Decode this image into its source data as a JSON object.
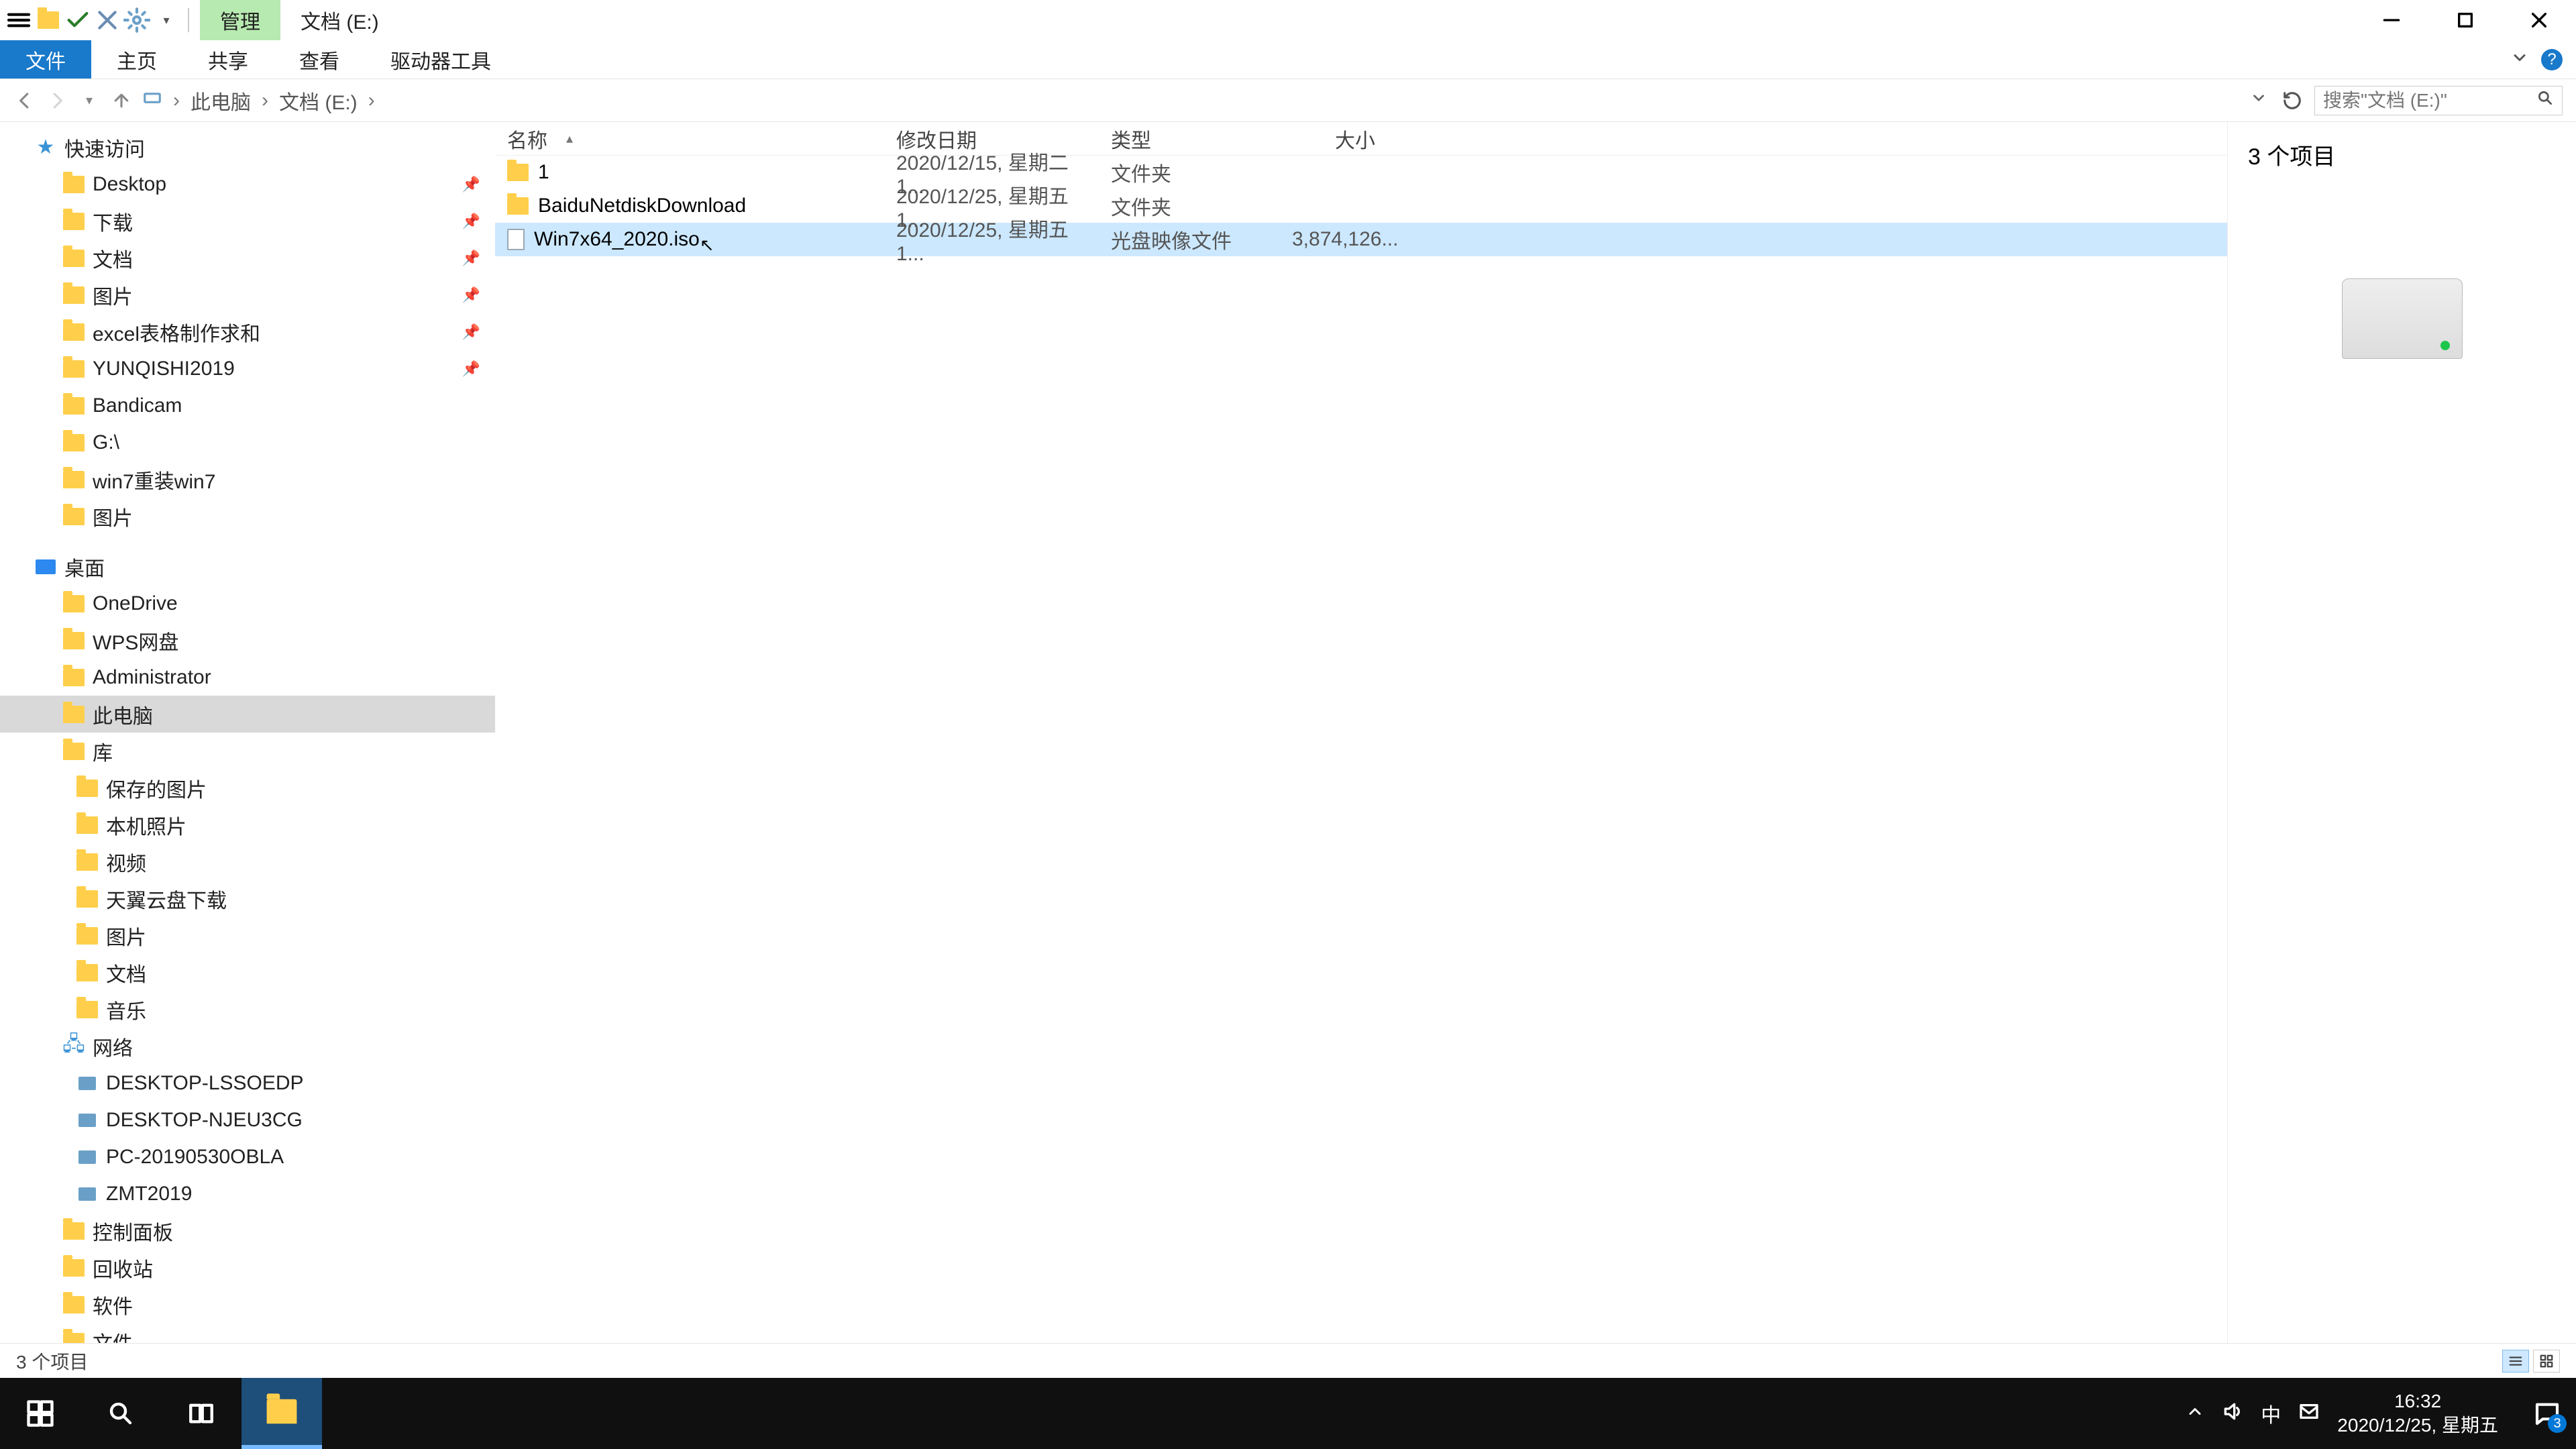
{
  "window": {
    "title": "文档 (E:)",
    "context_tab": "管理"
  },
  "ribbon": {
    "file": "文件",
    "home": "主页",
    "share": "共享",
    "view": "查看",
    "drive_tools": "驱动器工具"
  },
  "breadcrumb": {
    "root": "此电脑",
    "current": "文档 (E:)"
  },
  "search": {
    "placeholder": "搜索\"文档 (E:)\""
  },
  "columns": {
    "name": "名称",
    "date": "修改日期",
    "type": "类型",
    "size": "大小"
  },
  "rows": [
    {
      "icon": "folder",
      "name": "1",
      "date": "2020/12/15, 星期二 1...",
      "type": "文件夹",
      "size": "",
      "selected": false
    },
    {
      "icon": "folder",
      "name": "BaiduNetdiskDownload",
      "date": "2020/12/25, 星期五 1...",
      "type": "文件夹",
      "size": "",
      "selected": false
    },
    {
      "icon": "file",
      "name": "Win7x64_2020.iso",
      "date": "2020/12/25, 星期五 1...",
      "type": "光盘映像文件",
      "size": "3,874,126...",
      "selected": true
    }
  ],
  "nav": {
    "quick_access": "快速访问",
    "quick_items": [
      {
        "label": "Desktop",
        "pin": true
      },
      {
        "label": "下载",
        "pin": true
      },
      {
        "label": "文档",
        "pin": true
      },
      {
        "label": "图片",
        "pin": true
      },
      {
        "label": "excel表格制作求和",
        "pin": true
      },
      {
        "label": "YUNQISHI2019",
        "pin": true
      },
      {
        "label": "Bandicam",
        "pin": false
      },
      {
        "label": "G:\\",
        "pin": false
      },
      {
        "label": "win7重装win7",
        "pin": false
      },
      {
        "label": "图片",
        "pin": false
      }
    ],
    "desktop": "桌面",
    "desktop_items": [
      "OneDrive",
      "WPS网盘",
      "Administrator",
      "此电脑",
      "库"
    ],
    "lib_items": [
      "保存的图片",
      "本机照片",
      "视频",
      "天翼云盘下载",
      "图片",
      "文档",
      "音乐"
    ],
    "network": "网络",
    "net_items": [
      "DESKTOP-LSSOEDP",
      "DESKTOP-NJEU3CG",
      "PC-20190530OBLA",
      "ZMT2019"
    ],
    "control_panel": "控制面板",
    "recycle": "回收站",
    "soft": "软件",
    "docs": "文件"
  },
  "preview": {
    "count_text": "3 个项目"
  },
  "status": {
    "text": "3 个项目"
  },
  "tray": {
    "ime": "中",
    "time": "16:32",
    "date": "2020/12/25, 星期五",
    "badge": "3"
  }
}
